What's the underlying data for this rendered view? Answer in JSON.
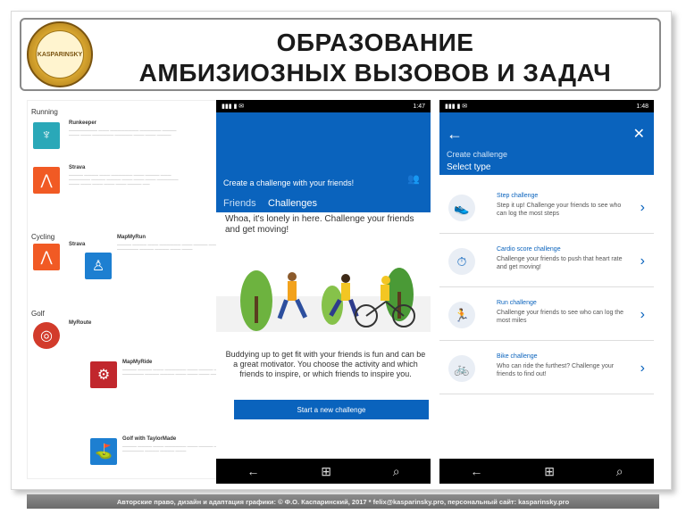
{
  "slide": {
    "title_line1": "ОБРАЗОВАНИЕ",
    "title_line2": "АМБИЗИОЗНЫХ ВЫЗОВОВ И ЗАДАЧ",
    "logo_text": "KASPARINSKY",
    "footer": "Авторские право, дизайн и адаптация графики: © Ф.О. Каспаринский, 2017 * felix@kasparinsky.pro, персональный сайт: kasparinsky.pro"
  },
  "app_list": {
    "categories": [
      "Running",
      "Cycling",
      "Golf"
    ],
    "apps": [
      {
        "name": "Runkeeper",
        "icon": "runner-icon",
        "color": "#2aa8b8"
      },
      {
        "name": "Strava",
        "icon": "strava-icon",
        "color": "#f15a24"
      },
      {
        "name": "Strava",
        "icon": "strava-icon",
        "color": "#f15a24"
      },
      {
        "name": "MapMyRun",
        "icon": "runner-icon",
        "color": "#1d7fd1"
      },
      {
        "name": "MyRoute",
        "icon": "golf-icon",
        "color": "#d23b2b"
      },
      {
        "name": "MapMyRide",
        "icon": "bike-icon",
        "color": "#c1272d"
      },
      {
        "name": "Golf with TaylorMade",
        "icon": "golfer-icon",
        "color": "#1d7fd1"
      }
    ]
  },
  "phone1": {
    "status_time": "1:47",
    "header_create": "Create a challenge with your friends!",
    "tab_friends": "Friends",
    "tab_challenges": "Challenges",
    "empty_text": "Whoa, it's lonely in here. Challenge your friends and get moving!",
    "body_text": "Buddying up to get fit with your friends is fun and can be a great motivator. You choose the activity and which friends to inspire, or which friends to inspire you.",
    "button": "Start a new challenge"
  },
  "phone2": {
    "status_time": "1:48",
    "create": "Create challenge",
    "select": "Select type",
    "challenges": [
      {
        "title": "Step challenge",
        "desc": "Step it up! Challenge your friends to see who can log the most steps",
        "icon": "shoe-icon"
      },
      {
        "title": "Cardio score challenge",
        "desc": "Challenge your friends to push that heart rate and get moving!",
        "icon": "stopwatch-icon"
      },
      {
        "title": "Run challenge",
        "desc": "Challenge your friends to see who can log the most miles",
        "icon": "runner-icon"
      },
      {
        "title": "Bike challenge",
        "desc": "Who can ride the furthest? Challenge your friends to find out!",
        "icon": "bike-icon"
      }
    ]
  }
}
